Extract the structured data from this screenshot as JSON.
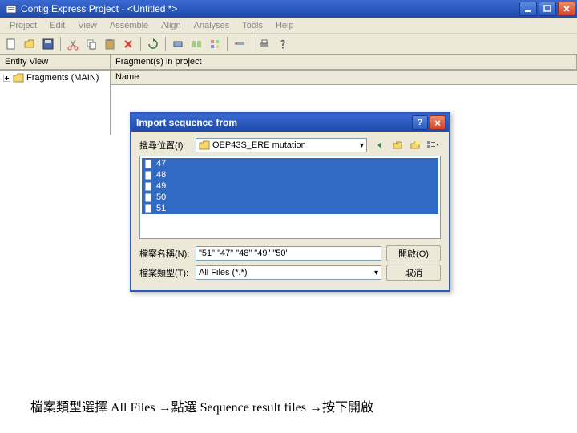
{
  "titlebar": {
    "app_title": "Contig.Express Project - <Untitled *>"
  },
  "menu": {
    "items": [
      "Project",
      "Edit",
      "View",
      "Assemble",
      "Align",
      "Analyses",
      "Tools",
      "Help"
    ]
  },
  "columns": {
    "left_header": "Entity View",
    "right_header": "Fragment(s) in project",
    "name_col": "Name"
  },
  "tree": {
    "root": "Fragments (MAIN)"
  },
  "dialog": {
    "title": "Import sequence from",
    "lookin_label": "搜尋位置(I):",
    "folder_name": "OEP43S_ERE mutation",
    "files": [
      "47",
      "48",
      "49",
      "50",
      "51"
    ],
    "filename_label": "檔案名稱(N):",
    "filename_value": "\"51\" \"47\" \"48\" \"49\" \"50\"",
    "filetype_label": "檔案類型(T):",
    "filetype_value": "All Files (*.*)",
    "open_btn": "開啟(O)",
    "cancel_btn": "取消"
  },
  "caption": "檔案類型選擇 All Files →點選 Sequence result files →按下開啟"
}
